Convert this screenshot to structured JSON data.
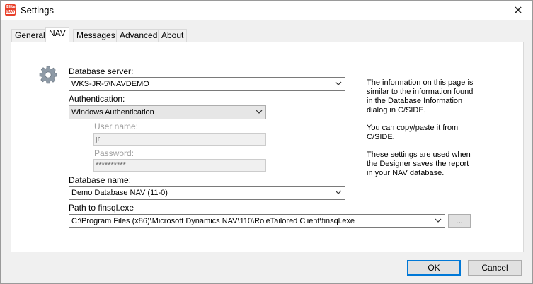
{
  "window": {
    "title": "Settings",
    "app_icon": "nav-report-designer-icon",
    "app_icon_text_top": "Elite",
    "app_icon_text_bottom": "NAV"
  },
  "tabs": [
    {
      "label": "General",
      "active": false
    },
    {
      "label": "NAV",
      "active": true
    },
    {
      "label": "Messages",
      "active": false
    },
    {
      "label": "Advanced",
      "active": false
    },
    {
      "label": "About",
      "active": false
    }
  ],
  "nav": {
    "database_server": {
      "label": "Database server:",
      "value": "WKS-JR-5\\NAVDEMO"
    },
    "authentication": {
      "label": "Authentication:",
      "value": "Windows Authentication"
    },
    "user_name": {
      "label": "User name:",
      "value": "jr"
    },
    "password": {
      "label": "Password:",
      "value": "**********"
    },
    "database_name": {
      "label": "Database name:",
      "value": "Demo Database NAV (11-0)"
    },
    "finsql_path": {
      "label": "Path to finsql.exe",
      "value": "C:\\Program Files (x86)\\Microsoft Dynamics NAV\\110\\RoleTailored Client\\finsql.exe"
    },
    "browse_label": "..."
  },
  "info": {
    "para1": [
      "The information on this page is",
      "similar to the information found",
      "in the Database Information",
      "dialog in C/SIDE."
    ],
    "para2": [
      "You can copy/paste it from",
      "C/SIDE."
    ],
    "para3": [
      "These settings are used when",
      "the Designer saves the report",
      "in your NAV database."
    ]
  },
  "buttons": {
    "ok": "OK",
    "cancel": "Cancel"
  },
  "icons": {
    "settings": "gear-icon",
    "close": "close-icon",
    "dropdown": "chevron-down-icon"
  }
}
